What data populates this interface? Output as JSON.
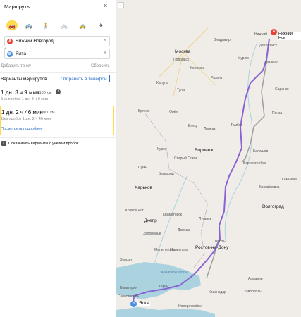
{
  "panel": {
    "title": "Маршруты",
    "close": "×",
    "modes": [
      {
        "icon": "car-icon",
        "glyph": "🚗"
      },
      {
        "icon": "bus-icon",
        "glyph": "🚌"
      },
      {
        "icon": "walk-icon",
        "glyph": "🚶"
      },
      {
        "icon": "bike-icon",
        "glyph": "🚲"
      },
      {
        "icon": "taxi-icon",
        "glyph": "🚕"
      },
      {
        "icon": "plane-icon",
        "glyph": "✈"
      }
    ],
    "from": {
      "letter": "A",
      "value": "Нижний Новгород",
      "clear": "×"
    },
    "to": {
      "letter": "B",
      "value": "Ялта",
      "clear": "×"
    },
    "swap": "⇅",
    "add_point": "Добавить точку",
    "reset": "Сбросить",
    "options_label": "Варианты маршрутов",
    "send_phone": "Отправить в телефон",
    "routes": [
      {
        "time": "1 дн. 3 ч 9 мин",
        "distance": "2 100 км",
        "no_traffic": "Без пробок 1 дн. 3 ч 9 мин",
        "info": "i"
      },
      {
        "time": "1 дн. 2 ч 46 мин",
        "distance": "2 000 км",
        "no_traffic": "Без пробок 1 дн. 2 ч 46 мин",
        "details": "Посмотреть подробнее"
      }
    ],
    "traffic_option": "Показывать варианты с учётом пробок",
    "check": "✓"
  },
  "map": {
    "back": "‹",
    "start_pin": "A",
    "start_label": "Нижний Нов",
    "end_pin": "B",
    "end_label": "Ялта",
    "labels": {
      "novgorod": "Нижний",
      "vladimir": "Владимир",
      "moscow": "Москва",
      "podolsk": "Подольск",
      "kaluga": "Калуга",
      "tula": "Тула",
      "ryazan": "Рязань",
      "kolomna": "Коломна",
      "bryansk": "Брянск",
      "orel": "Орёл",
      "kursk": "Курск",
      "voronezh": "Воронеж",
      "lipetsk": "Липецк",
      "tambov": "Тамбов",
      "belgorod": "Белгород",
      "sumy": "Сумы",
      "kharkov": "Харьков",
      "saransk": "Саранск",
      "penza": "Пенза",
      "balashov": "Балашов",
      "volgograd": "Волгоград",
      "dnepr": "Днепр",
      "zaporozhye": "Запорожье",
      "donetsk": "Донецк",
      "lugansk": "Луганск",
      "mariupol": "Мариуполь",
      "rostov": "Ростов-на-Дону",
      "azov_sea": "Азовское море",
      "krasnodar": "Краснодар",
      "stavropol": "Ставрополь",
      "novorossiysk": "Новороссийск",
      "kramatorsk": "Краматорск",
      "kryvyi": "Кривой Рог",
      "starooskol": "Старый Оскол",
      "murom": "Муром",
      "dzerzhinsk": "Дзержинск",
      "elets": "Елец",
      "mikhaylovka": "Михайловка",
      "kamyshin": "Камышин",
      "borisoglebsk": "Борисоглебск",
      "arzamas": "Арзамас",
      "kerch": "Керчь",
      "shakhty": "Шахты",
      "armavir": "Армавир",
      "kherson": "Херсон",
      "sevastopol": "Севастополь",
      "evpatoria": "Евпатория",
      "melitopol": "Мелитополь"
    },
    "colors": {
      "route_main": "#8a63d2",
      "route_alt": "#9e9e9e",
      "sea": "#aad3df"
    }
  }
}
